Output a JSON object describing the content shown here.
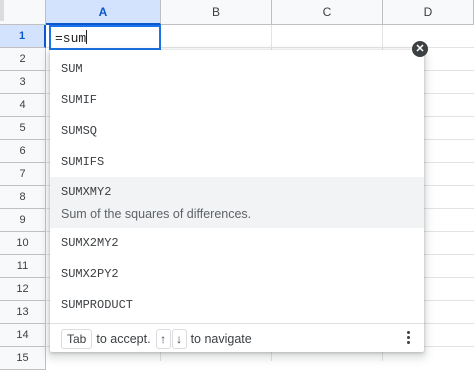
{
  "columns": [
    "A",
    "B",
    "C",
    "D"
  ],
  "rows": [
    "1",
    "2",
    "3",
    "4",
    "5",
    "6",
    "7",
    "8",
    "9",
    "10",
    "11",
    "12",
    "13",
    "14",
    "15"
  ],
  "active_cell": {
    "value": "=sum"
  },
  "autocomplete": {
    "close_icon": "close-icon",
    "suggestions": [
      {
        "name": "SUM"
      },
      {
        "name": "SUMIF"
      },
      {
        "name": "SUMSQ"
      },
      {
        "name": "SUMIFS"
      },
      {
        "name": "SUMXMY2",
        "description": "Sum of the squares of differences."
      },
      {
        "name": "SUMX2MY2"
      },
      {
        "name": "SUMX2PY2"
      },
      {
        "name": "SUMPRODUCT"
      }
    ],
    "footer": {
      "tab_key": "Tab",
      "accept_text": "to accept.",
      "up_arrow": "↑",
      "down_arrow": "↓",
      "navigate_text": "to navigate"
    }
  },
  "colors": {
    "accent": "#1a73e8",
    "header_active": "#d3e3fd"
  }
}
